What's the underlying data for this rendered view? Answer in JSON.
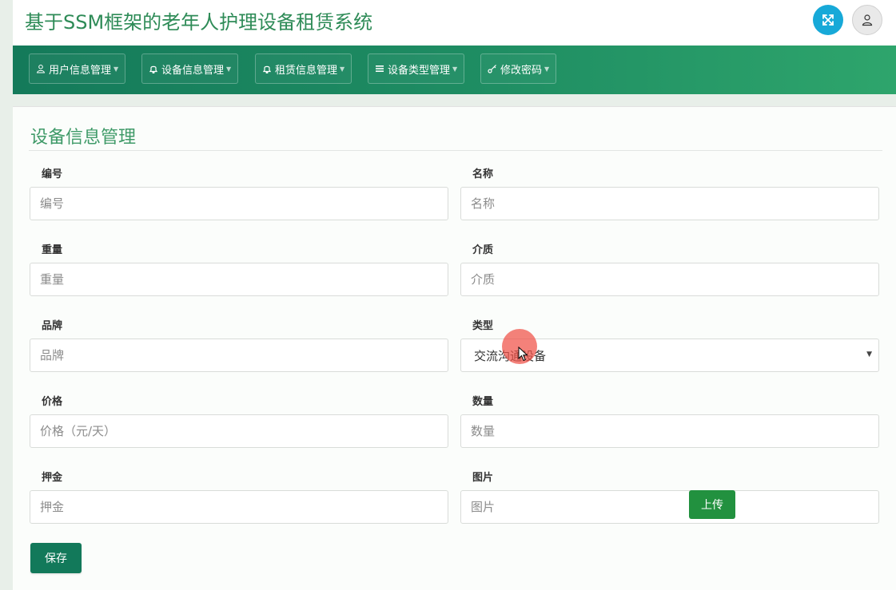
{
  "header": {
    "title": "基于SSM框架的老年人护理设备租赁系统",
    "fullscreen_icon": "expand-arrows-icon",
    "user_icon": "user-icon",
    "accent_color": "#17a9d8"
  },
  "nav": {
    "items": [
      {
        "label": "用户信息管理",
        "icon": "user-icon"
      },
      {
        "label": "设备信息管理",
        "icon": "bell-icon"
      },
      {
        "label": "租赁信息管理",
        "icon": "bell-icon"
      },
      {
        "label": "设备类型管理",
        "icon": "list-icon"
      },
      {
        "label": "修改密码",
        "icon": "key-icon"
      }
    ],
    "colors": [
      "#147a5a",
      "#2ea56c"
    ]
  },
  "page": {
    "title": "设备信息管理"
  },
  "form": {
    "code": {
      "label": "编号",
      "placeholder": "编号",
      "value": ""
    },
    "name": {
      "label": "名称",
      "placeholder": "名称",
      "value": ""
    },
    "weight": {
      "label": "重量",
      "placeholder": "重量",
      "value": ""
    },
    "medium": {
      "label": "介质",
      "placeholder": "介质",
      "value": ""
    },
    "brand": {
      "label": "品牌",
      "placeholder": "品牌",
      "value": ""
    },
    "type": {
      "label": "类型",
      "value": "交流沟通设备"
    },
    "price": {
      "label": "价格",
      "placeholder": "价格（元/天）",
      "value": ""
    },
    "quantity": {
      "label": "数量",
      "placeholder": "数量",
      "value": ""
    },
    "deposit": {
      "label": "押金",
      "placeholder": "押金",
      "value": ""
    },
    "image": {
      "label": "图片",
      "placeholder": "图片",
      "value": "",
      "upload_label": "上传"
    },
    "save_label": "保存"
  }
}
